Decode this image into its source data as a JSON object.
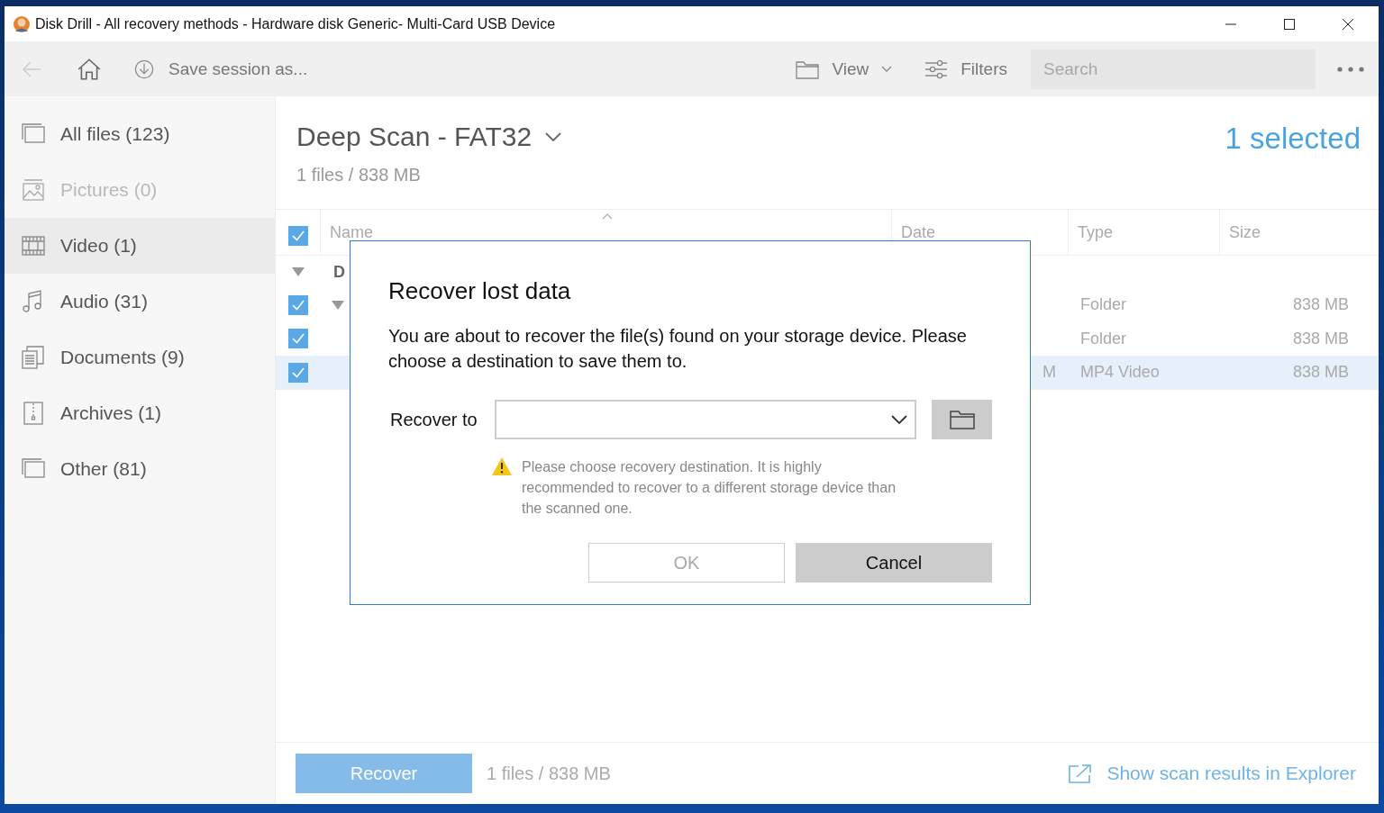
{
  "window": {
    "title": "Disk Drill - All recovery methods - Hardware disk Generic- Multi-Card USB Device"
  },
  "toolbar": {
    "back_disabled": true,
    "save_label": "Save session as...",
    "view_label": "View",
    "filters_label": "Filters",
    "search": {
      "placeholder": "Search"
    }
  },
  "sidebar": {
    "items": [
      {
        "label": "All files (123)",
        "kind": "all",
        "selected": false,
        "disabled": false
      },
      {
        "label": "Pictures (0)",
        "kind": "pictures",
        "selected": false,
        "disabled": true
      },
      {
        "label": "Video (1)",
        "kind": "video",
        "selected": true,
        "disabled": false
      },
      {
        "label": "Audio (31)",
        "kind": "audio",
        "selected": false,
        "disabled": false
      },
      {
        "label": "Documents (9)",
        "kind": "documents",
        "selected": false,
        "disabled": false
      },
      {
        "label": "Archives (1)",
        "kind": "archives",
        "selected": false,
        "disabled": false
      },
      {
        "label": "Other (81)",
        "kind": "other",
        "selected": false,
        "disabled": false
      }
    ]
  },
  "header": {
    "title": "Deep Scan - FAT32",
    "summary": "1 files / 838 MB",
    "selection": "1 selected"
  },
  "table": {
    "all_checked": true,
    "columns": [
      "Name",
      "Date",
      "Type",
      "Size"
    ],
    "rows": [
      {
        "kind": "group",
        "expanded": true,
        "name": "D"
      },
      {
        "kind": "file",
        "checked": true,
        "selected": false,
        "expanded": true,
        "type": "Folder",
        "size": "838 MB"
      },
      {
        "kind": "file",
        "checked": true,
        "selected": false,
        "type": "Folder",
        "size": "838 MB"
      },
      {
        "kind": "file",
        "checked": true,
        "selected": true,
        "date": "M",
        "type": "MP4 Video",
        "size": "838 MB"
      }
    ]
  },
  "dialog": {
    "title": "Recover lost data",
    "message": "You are about to recover the file(s) found on your storage device. Please choose a destination to save them to.",
    "recover_label": "Recover to",
    "warning": "Please choose recovery destination. It is highly recommended to recover to a different storage device than the scanned one.",
    "buttons": [
      {
        "label": "OK",
        "kind": "ok",
        "disabled": true
      },
      {
        "label": "Cancel",
        "kind": "cancel",
        "disabled": false
      }
    ]
  },
  "footer": {
    "recover_label": "Recover",
    "summary": "1 files / 838 MB",
    "link": "Show scan results in Explorer"
  }
}
